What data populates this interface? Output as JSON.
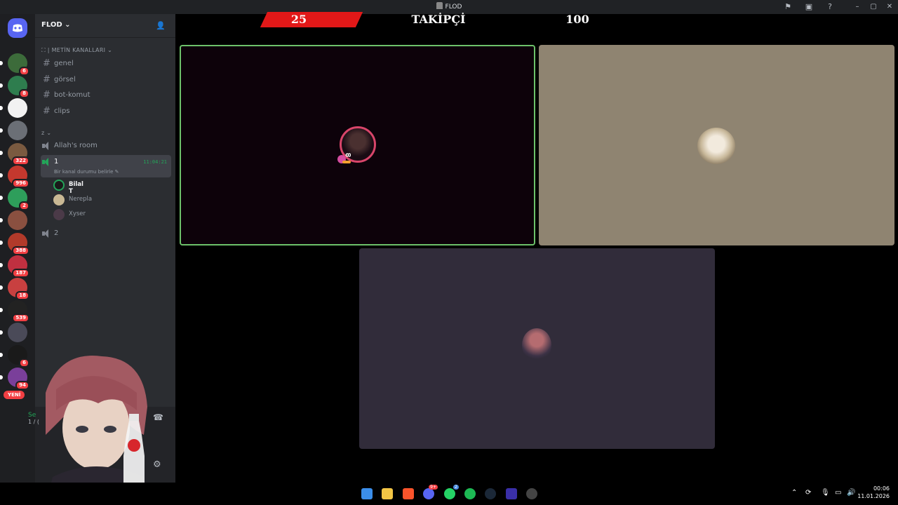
{
  "window": {
    "title": "FLOD"
  },
  "overlay": {
    "left_number": "25",
    "label": "TAKİPÇİ",
    "right_number": "100"
  },
  "server": {
    "name": "FLOD"
  },
  "guild_badges": [
    "6",
    "8",
    "",
    "",
    "322",
    "996",
    "2",
    "",
    "388",
    "187",
    "18",
    "539",
    "",
    "6",
    "94"
  ],
  "text_category": "| METİN KANALLARI",
  "text_channels": [
    "genel",
    "görsel",
    "bot-komut",
    "clips"
  ],
  "voice_category": "z",
  "voice_channels": {
    "room": "Allah's room",
    "active": "1",
    "active_time": "11:04:21",
    "active_status": "Bir kanal durumu belirle",
    "second": "2"
  },
  "members": [
    "Bilal T",
    "Nerepla",
    "Xyser"
  ],
  "new_badge": "YENİ",
  "voice_status_partial": "Se",
  "voice_sub_partial": "1 / (",
  "taskbar": {
    "discord_badge": "9+",
    "whatsapp_badge": "2"
  },
  "clock": {
    "time": "00:06",
    "date": "11.01.2026"
  },
  "colors": {
    "speaking_border": "#6dc16a",
    "overlay_red": "#e21818",
    "discord_green": "#23a559"
  }
}
